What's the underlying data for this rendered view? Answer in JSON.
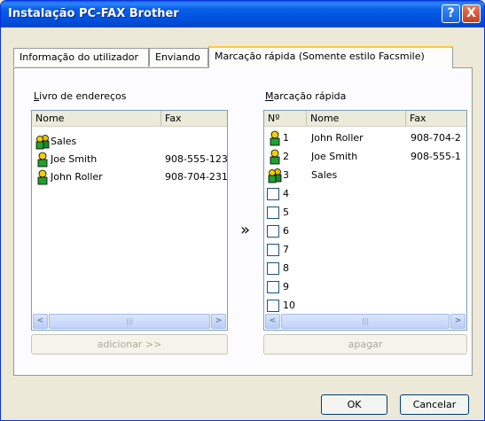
{
  "window": {
    "title": "Instalação PC-FAX Brother",
    "help": "?",
    "close": "X"
  },
  "tabs": [
    {
      "label": "Informação do utilizador"
    },
    {
      "label": "Enviando"
    },
    {
      "label": "Marcação rápida (Somente estilo Facsmile)"
    }
  ],
  "address_book": {
    "label_underline": "L",
    "label_rest": "ivro de endereços",
    "columns": {
      "name": "Nome",
      "fax": "Fax"
    },
    "rows": [
      {
        "name": "Sales",
        "fax": "",
        "icon": "group-icon"
      },
      {
        "name": "Joe Smith",
        "fax": "908-555-123",
        "icon": "person-icon"
      },
      {
        "name": "John Roller",
        "fax": "908-704-231",
        "icon": "person-icon"
      }
    ],
    "add_button": "adicionar >>"
  },
  "speed_dial": {
    "label_underline": "M",
    "label_rest": "arcação rápida",
    "columns": {
      "num": "Nº",
      "name": "Nome",
      "fax": "Fax"
    },
    "rows": [
      {
        "num": "1",
        "name": "John Roller",
        "fax": "908-704-2",
        "icon": "person-icon"
      },
      {
        "num": "2",
        "name": "Joe Smith",
        "fax": "908-555-1",
        "icon": "person-icon"
      },
      {
        "num": "3",
        "name": "Sales",
        "fax": "",
        "icon": "group-icon"
      },
      {
        "num": "4",
        "name": "",
        "fax": "",
        "icon": "empty-slot"
      },
      {
        "num": "5",
        "name": "",
        "fax": "",
        "icon": "empty-slot"
      },
      {
        "num": "6",
        "name": "",
        "fax": "",
        "icon": "empty-slot"
      },
      {
        "num": "7",
        "name": "",
        "fax": "",
        "icon": "empty-slot"
      },
      {
        "num": "8",
        "name": "",
        "fax": "",
        "icon": "empty-slot"
      },
      {
        "num": "9",
        "name": "",
        "fax": "",
        "icon": "empty-slot"
      },
      {
        "num": "10",
        "name": "",
        "fax": "",
        "icon": "empty-slot"
      }
    ],
    "delete_button": "apagar"
  },
  "move_arrow": "»",
  "footer": {
    "ok": "OK",
    "cancel": "Cancelar"
  },
  "scroll": {
    "left": "<",
    "right": ">",
    "grip": "|||"
  },
  "colors": {
    "titlebar": "#0054e3",
    "tab_highlight": "#ffc83c",
    "face": "#ece9d8"
  }
}
